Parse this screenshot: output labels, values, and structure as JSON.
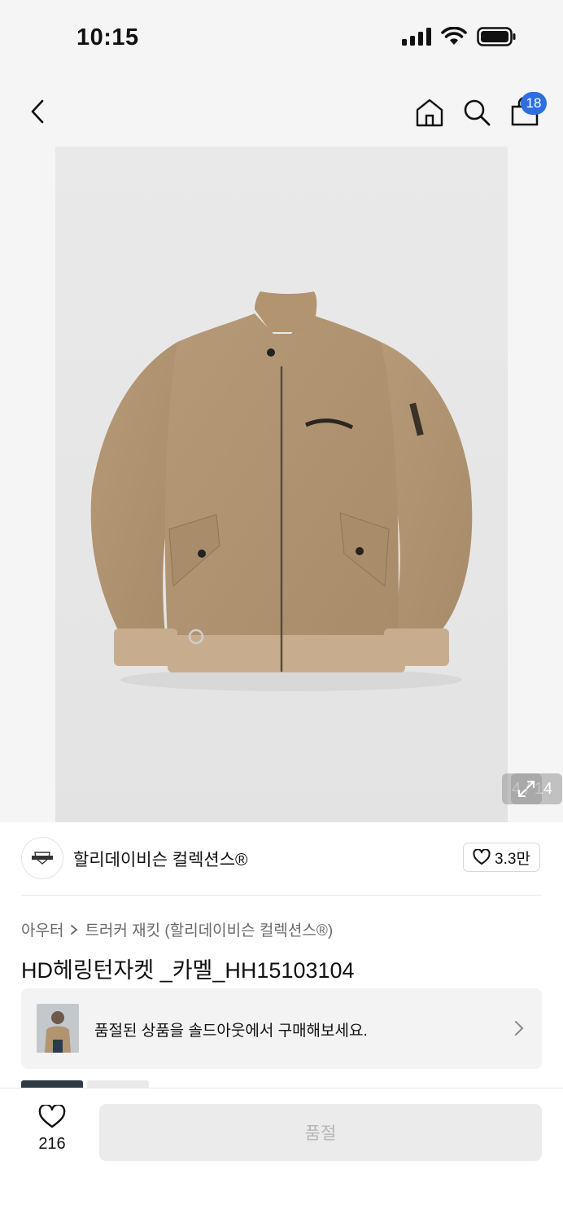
{
  "status_bar": {
    "time": "10:15"
  },
  "header": {
    "cart_count": "18"
  },
  "gallery": {
    "counter": "4 / 14"
  },
  "brand": {
    "name": "할리데이비슨 컬렉션스®",
    "likes": "3.3만"
  },
  "breadcrumb": {
    "category": "아우터",
    "subcategory": "트러커 재킷 (할리데이비슨 컬렉션스®)"
  },
  "product": {
    "title": "HD헤링턴자켓 _카멜_HH15103104"
  },
  "soldout_banner": {
    "text": "품절된 상품을 솔드아웃에서 구매해보세요."
  },
  "bottom_bar": {
    "wish_count": "216",
    "buy_label": "품절"
  },
  "colors": {
    "accent_blue": "#2f6de1",
    "jacket_camel": "#b29470",
    "disabled_button": "#ebebeb"
  }
}
